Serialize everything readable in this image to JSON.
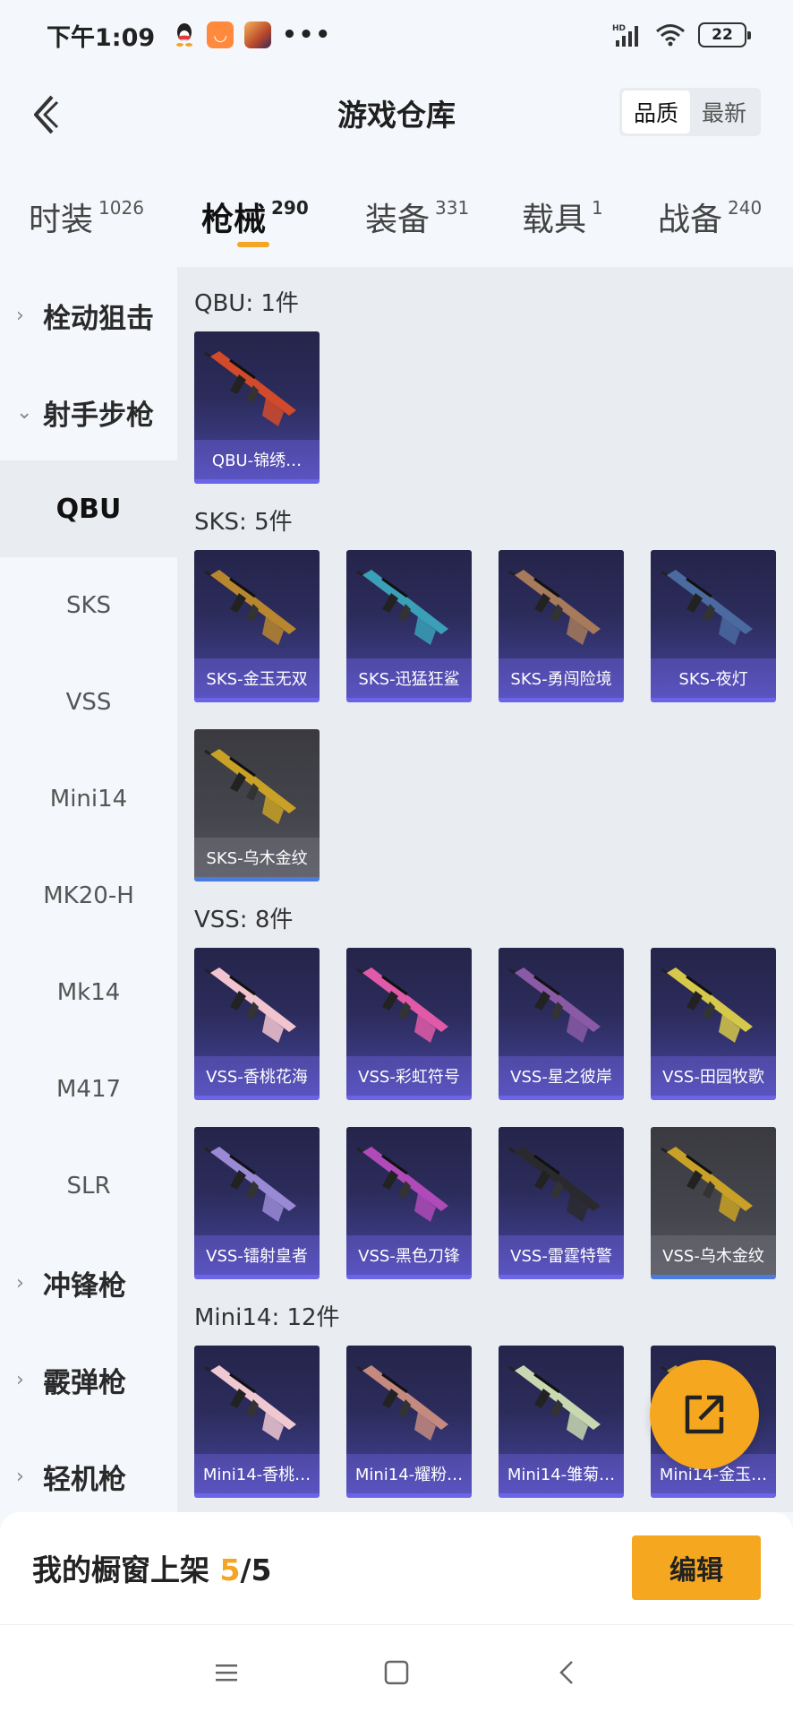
{
  "status": {
    "time": "下午1:09",
    "network": "HD",
    "battery": "22",
    "more": "•••"
  },
  "header": {
    "title": "游戏仓库",
    "sort_options": [
      "品质",
      "最新"
    ]
  },
  "tabs": [
    {
      "label": "时装",
      "count": "1026"
    },
    {
      "label": "枪械",
      "count": "290"
    },
    {
      "label": "装备",
      "count": "331"
    },
    {
      "label": "载具",
      "count": "1"
    },
    {
      "label": "战备",
      "count": "240"
    }
  ],
  "sidebar": {
    "groups": [
      {
        "label": "栓动狙击",
        "expanded": false
      },
      {
        "label": "射手步枪",
        "expanded": true
      },
      {
        "label": "冲锋枪",
        "expanded": false
      },
      {
        "label": "霰弹枪",
        "expanded": false
      },
      {
        "label": "轻机枪",
        "expanded": false
      }
    ],
    "items": [
      "QBU",
      "SKS",
      "VSS",
      "Mini14",
      "MK20-H",
      "Mk14",
      "M417",
      "SLR"
    ],
    "active_item": "QBU"
  },
  "sections": [
    {
      "title": "QBU: 1件",
      "items": [
        {
          "name": "QBU-锦绣…",
          "grade": "purple",
          "gun_color": "#d24a2a"
        }
      ]
    },
    {
      "title": "SKS: 5件",
      "items": [
        {
          "name": "SKS-金玉无双",
          "grade": "purple",
          "gun_color": "#b8862e"
        },
        {
          "name": "SKS-迅猛狂鲨",
          "grade": "purple",
          "gun_color": "#3aa0b8"
        },
        {
          "name": "SKS-勇闯险境",
          "grade": "purple",
          "gun_color": "#a67a5a"
        },
        {
          "name": "SKS-夜灯",
          "grade": "purple",
          "gun_color": "#4a6aa0"
        },
        {
          "name": "SKS-乌木金纹",
          "grade": "grey",
          "gun_color": "#c9a126"
        }
      ]
    },
    {
      "title": "VSS: 8件",
      "items": [
        {
          "name": "VSS-香桃花海",
          "grade": "purple",
          "gun_color": "#f2c4d0"
        },
        {
          "name": "VSS-彩虹符号",
          "grade": "purple",
          "gun_color": "#e05aa8"
        },
        {
          "name": "VSS-星之彼岸",
          "grade": "purple",
          "gun_color": "#8a5aa6"
        },
        {
          "name": "VSS-田园牧歌",
          "grade": "purple",
          "gun_color": "#d6c84a"
        },
        {
          "name": "VSS-镭射皇者",
          "grade": "purple",
          "gun_color": "#9a8ad6"
        },
        {
          "name": "VSS-黑色刀锋",
          "grade": "purple",
          "gun_color": "#b04ab8"
        },
        {
          "name": "VSS-雷霆特警",
          "grade": "purple",
          "gun_color": "#2a2a2e"
        },
        {
          "name": "VSS-乌木金纹",
          "grade": "grey",
          "gun_color": "#c9a126"
        }
      ]
    },
    {
      "title": "Mini14: 12件",
      "items": [
        {
          "name": "Mini14-香桃…",
          "grade": "purple",
          "gun_color": "#f0c8d2"
        },
        {
          "name": "Mini14-耀粉…",
          "grade": "purple",
          "gun_color": "#c48a80"
        },
        {
          "name": "Mini14-雏菊…",
          "grade": "purple",
          "gun_color": "#c8d8b0"
        },
        {
          "name": "Mini14-金玉…",
          "grade": "purple",
          "gun_color": "#c9a126"
        }
      ]
    }
  ],
  "bottom": {
    "shelf_label": "我的橱窗上架",
    "shelf_used": "5",
    "shelf_total": "/5",
    "edit_label": "编辑"
  }
}
